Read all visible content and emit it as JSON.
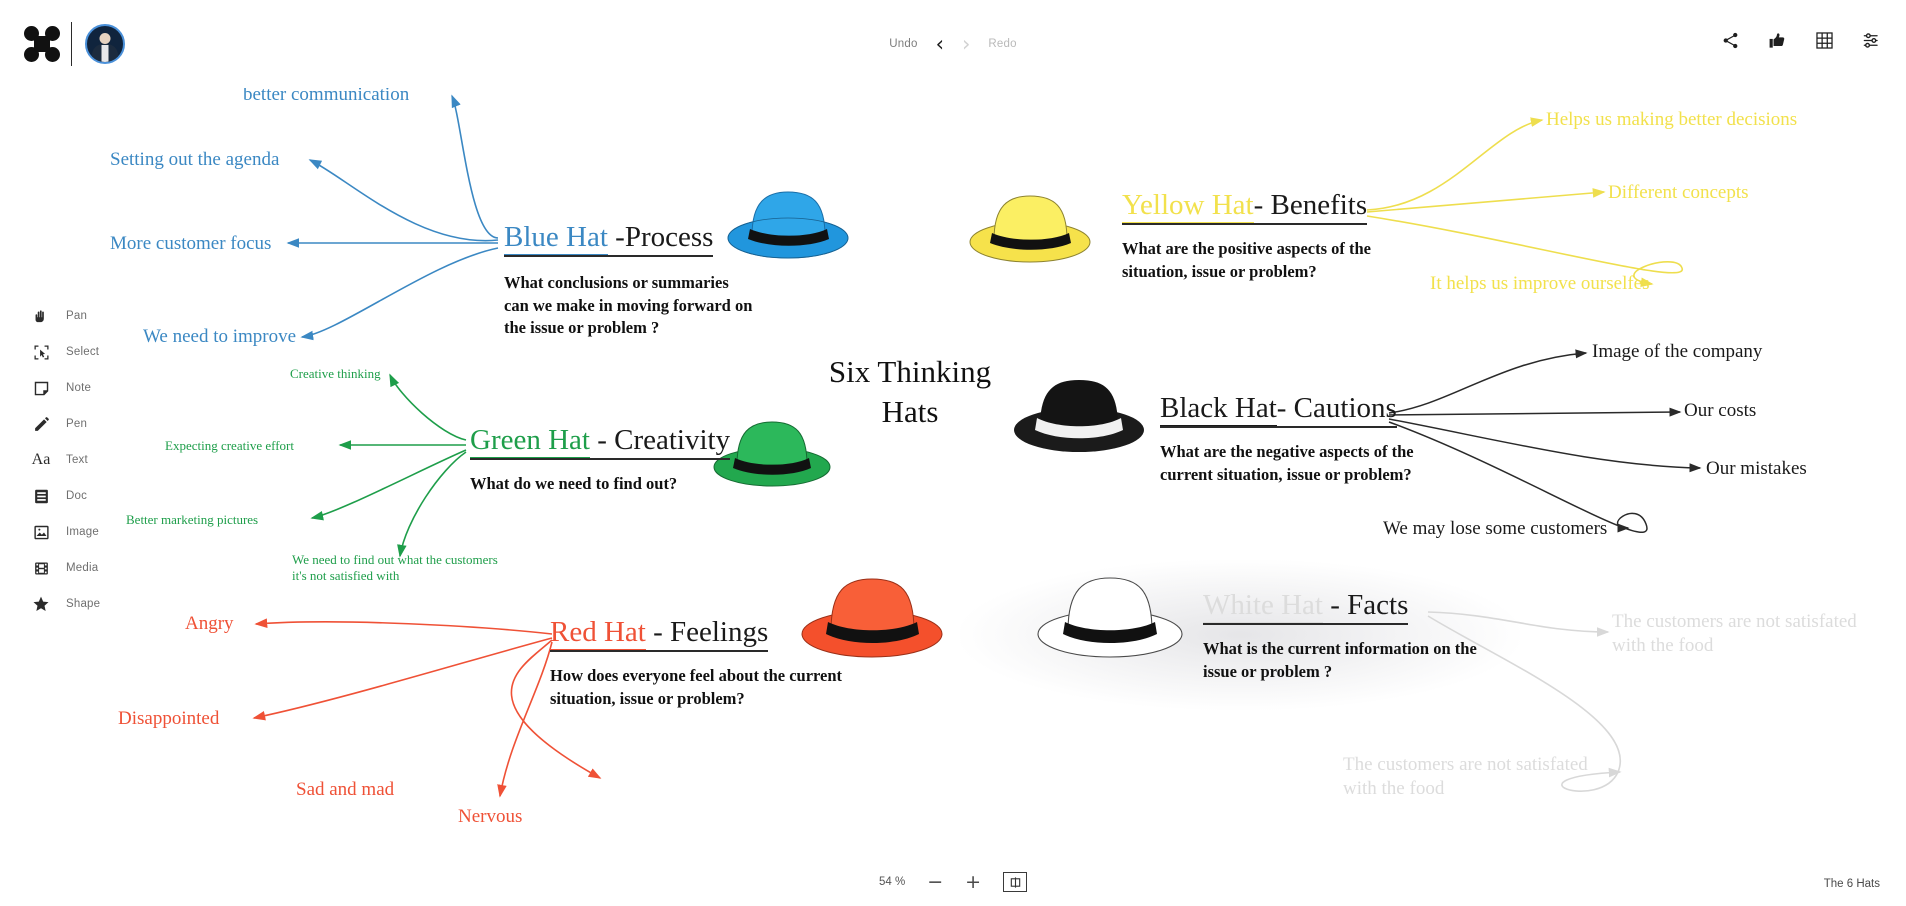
{
  "app": {
    "logo_name": "app-logo",
    "board_name": "The 6 Hats"
  },
  "toolbar_top": {
    "undo_label": "Undo",
    "redo_label": "Redo",
    "back_glyph": "‹",
    "forward_glyph": "›",
    "icons": [
      {
        "name": "share-icon",
        "label": "Share"
      },
      {
        "name": "thumbs-up-icon",
        "label": "Like"
      },
      {
        "name": "grid-icon",
        "label": "Grid"
      },
      {
        "name": "settings-sliders-icon",
        "label": "Settings"
      }
    ]
  },
  "sidebar": {
    "items": [
      {
        "label": "Pan",
        "icon": "hand-icon"
      },
      {
        "label": "Select",
        "icon": "select-marquee-icon"
      },
      {
        "label": "Note",
        "icon": "sticky-note-icon"
      },
      {
        "label": "Pen",
        "icon": "pencil-icon"
      },
      {
        "label": "Text",
        "icon": "text-aa-icon"
      },
      {
        "label": "Doc",
        "icon": "document-icon"
      },
      {
        "label": "Image",
        "icon": "image-icon"
      },
      {
        "label": "Media",
        "icon": "film-icon"
      },
      {
        "label": "Shape",
        "icon": "star-icon"
      }
    ]
  },
  "canvas": {
    "center_title": "Six Thinking Hats",
    "hats": [
      {
        "key": "blue",
        "color": "#3b88c3",
        "name": "Blue Hat",
        "suffix": " -Process",
        "question": "What conclusions or summaries can we make in moving forward on the issue or problem ?",
        "branches": [
          "better communication",
          "Setting out the agenda",
          "More customer focus",
          "We need to improve"
        ]
      },
      {
        "key": "yellow",
        "color": "#f2e14c",
        "name": "Yellow Hat",
        "suffix": "- Benefits",
        "question": "What are the positive aspects of the situation, issue or problem?",
        "branches": [
          "Helps us making better decisions",
          "Different concepts",
          "It helps us improve ourselfes"
        ]
      },
      {
        "key": "green",
        "color": "#1e9e4a",
        "name": "Green Hat",
        "suffix": " - Creativity",
        "question": "What do we need to find out?",
        "branches": [
          "Creative thinking",
          "Expecting creative effort",
          "Better marketing pictures",
          "We need to find out what the customers it's not satisfied with"
        ]
      },
      {
        "key": "black",
        "color": "#1a1a1a",
        "name": "Black Hat",
        "suffix": "- Cautions",
        "question": "What are the negative aspects of the current situation, issue or problem?",
        "branches": [
          "Image of the company",
          "Our costs",
          "Our mistakes",
          "We may lose some customers"
        ]
      },
      {
        "key": "red",
        "color": "#ef5136",
        "name": "Red Hat",
        "suffix": " - Feelings",
        "question": "How does everyone feel about the current situation, issue or problem?",
        "branches": [
          "Angry",
          "Disappointed",
          "Sad and mad",
          "Nervous"
        ]
      },
      {
        "key": "white",
        "color": "#dcdcdc",
        "name": "White Hat",
        "suffix": " - Facts",
        "question": "What is the current information on the issue or problem ?",
        "branches": [
          "The customers are not satisfated with the food",
          "The customers are not satisfated with the food"
        ]
      }
    ]
  },
  "zoom": {
    "value": "54 %",
    "minus_glyph": "−",
    "plus_glyph": "+"
  }
}
